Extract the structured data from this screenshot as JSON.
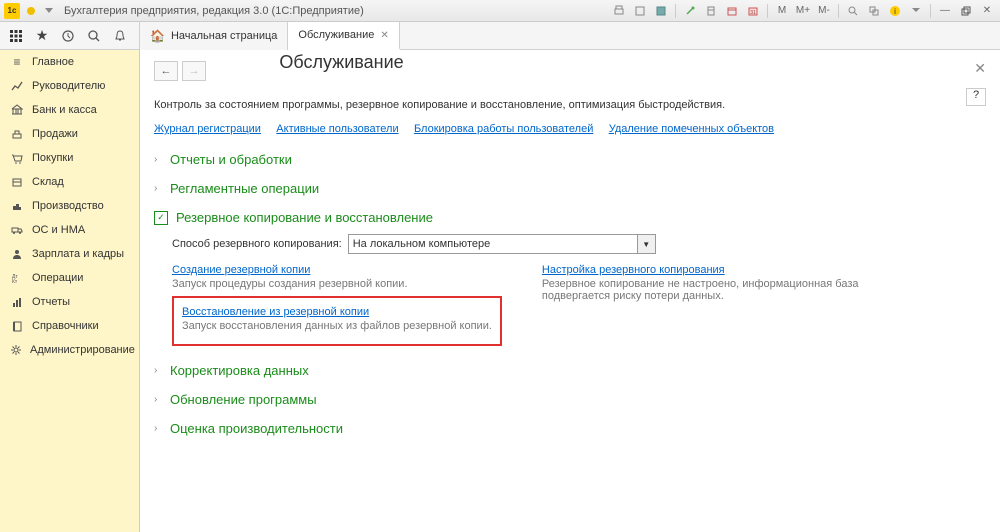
{
  "titlebar": {
    "title": "Бухгалтерия предприятия, редакция 3.0  (1С:Предприятие)",
    "logo": "1с",
    "right_buttons": {
      "m": "M",
      "mplus": "M+",
      "mr": "M-"
    }
  },
  "toolbar": {
    "tabs": [
      {
        "label": "Начальная страница",
        "closable": false,
        "active": false
      },
      {
        "label": "Обслуживание",
        "closable": true,
        "active": true
      }
    ]
  },
  "sidebar": {
    "items": [
      {
        "label": "Главное",
        "icon": "menu"
      },
      {
        "label": "Руководителю",
        "icon": "chart"
      },
      {
        "label": "Банк и касса",
        "icon": "bank"
      },
      {
        "label": "Продажи",
        "icon": "cart"
      },
      {
        "label": "Покупки",
        "icon": "basket"
      },
      {
        "label": "Склад",
        "icon": "box"
      },
      {
        "label": "Производство",
        "icon": "factory"
      },
      {
        "label": "ОС и НМА",
        "icon": "truck"
      },
      {
        "label": "Зарплата и кадры",
        "icon": "person"
      },
      {
        "label": "Операции",
        "icon": "ops"
      },
      {
        "label": "Отчеты",
        "icon": "report"
      },
      {
        "label": "Справочники",
        "icon": "book"
      },
      {
        "label": "Администрирование",
        "icon": "gear"
      }
    ]
  },
  "page": {
    "title": "Обслуживание",
    "description": "Контроль за состоянием программы, резервное копирование и восстановление, оптимизация быстродействия.",
    "top_links": [
      "Журнал регистрации",
      "Активные пользователи",
      "Блокировка работы пользователей",
      "Удаление помеченных объектов"
    ],
    "sections": {
      "reports": "Отчеты и обработки",
      "routine": "Регламентные операции",
      "backup": {
        "title": "Резервное копирование и восстановление",
        "method_label": "Способ резервного копирования:",
        "method_value": "На локальном компьютере",
        "create": {
          "link": "Создание резервной копии",
          "desc": "Запуск процедуры создания резервной копии."
        },
        "settings": {
          "link": "Настройка резервного копирования",
          "desc": "Резервное копирование не настроено, информационная база подвергается риску потери данных."
        },
        "restore": {
          "link": "Восстановление из резервной копии",
          "desc": "Запуск восстановления данных из файлов резервной копии."
        }
      },
      "correction": "Корректировка данных",
      "update": "Обновление программы",
      "perf": "Оценка производительности"
    },
    "help": "?"
  }
}
